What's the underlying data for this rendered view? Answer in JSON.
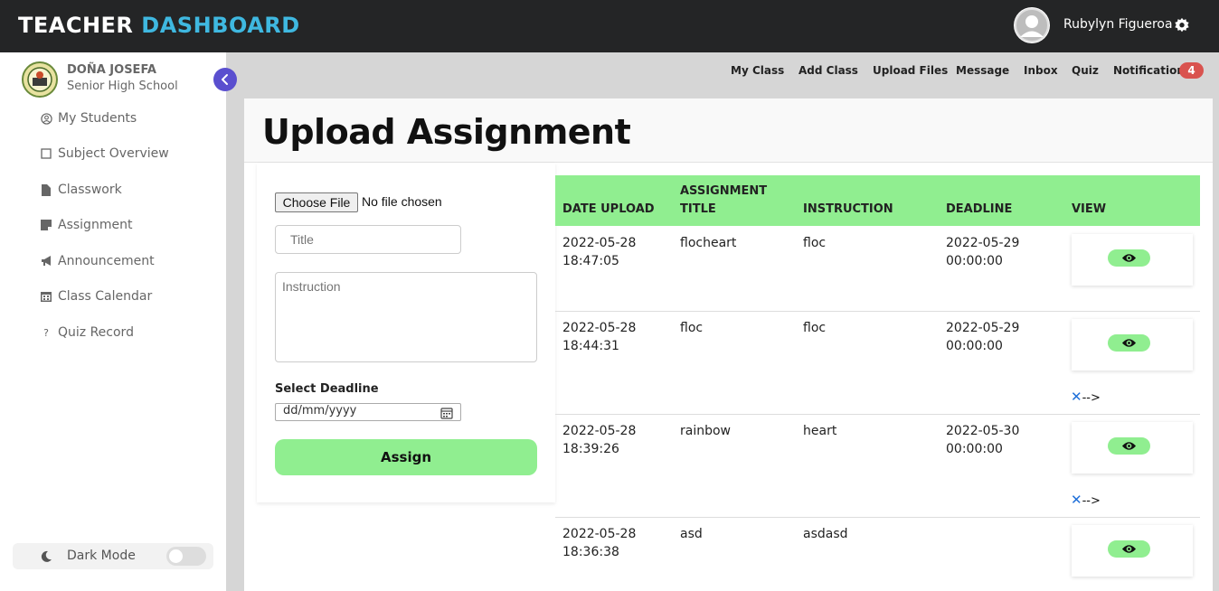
{
  "header": {
    "brand_part1": "TEACHER",
    "brand_part2": "DASHBOARD",
    "user_name": "Rubylyn Figueroa",
    "colors": {
      "topbar": "#242526",
      "brand_accent": "#3fb8e0"
    },
    "icons": {
      "avatar": "user-avatar-icon",
      "settings": "gear-icon"
    }
  },
  "sidebar": {
    "school_name": "DOÑA JOSEFA",
    "school_sub": "Senior High School",
    "items": [
      {
        "label": "My Students",
        "icon": "user-circle-icon"
      },
      {
        "label": "Subject Overview",
        "icon": "square-icon"
      },
      {
        "label": "Classwork",
        "icon": "file-icon"
      },
      {
        "label": "Assignment",
        "icon": "sticky-note-icon"
      },
      {
        "label": "Announcement",
        "icon": "megaphone-icon"
      },
      {
        "label": "Class Calendar",
        "icon": "calendar-icon"
      },
      {
        "label": "Quiz Record",
        "icon": "question-icon"
      }
    ],
    "dark_mode_label": "Dark Mode"
  },
  "topmenu": {
    "items": [
      "My Class",
      "Add Class",
      "Upload Files",
      "Message",
      "Inbox",
      "Quiz",
      "Notification"
    ],
    "notification_count": "4"
  },
  "main": {
    "title": "Upload Assignment",
    "form": {
      "choose_file_label": "Choose File",
      "no_file_text": "No file chosen",
      "title_placeholder": "Title",
      "instruction_placeholder": "Instruction",
      "deadline_label": "Select Deadline",
      "date_placeholder": "dd/mm/yyyy",
      "assign_label": "Assign",
      "button_color": "#90ee90"
    },
    "table": {
      "headers": {
        "date": "DATE UPLOAD",
        "title_line1": "ASSIGNMENT",
        "title_line2": "TITLE",
        "instruction": "INSTRUCTION",
        "deadline": "DEADLINE",
        "view": "VIEW"
      },
      "rows": [
        {
          "date": "2022-05-28",
          "time": "18:47:05",
          "title": "flocheart",
          "instruction": "floc",
          "deadline_date": "2022-05-29",
          "deadline_time": "00:00:00",
          "extra": ""
        },
        {
          "date": "2022-05-28",
          "time": "18:44:31",
          "title": "floc",
          "instruction": "floc",
          "deadline_date": "2022-05-29",
          "deadline_time": "00:00:00",
          "extra": "-->"
        },
        {
          "date": "2022-05-28",
          "time": "18:39:26",
          "title": "rainbow",
          "instruction": "heart",
          "deadline_date": "2022-05-30",
          "deadline_time": "00:00:00",
          "extra": "-->"
        },
        {
          "date": "2022-05-28",
          "time": "18:36:38",
          "title": "asd",
          "instruction": "asdasd",
          "deadline_date": "",
          "deadline_time": "",
          "extra": ""
        }
      ]
    }
  }
}
